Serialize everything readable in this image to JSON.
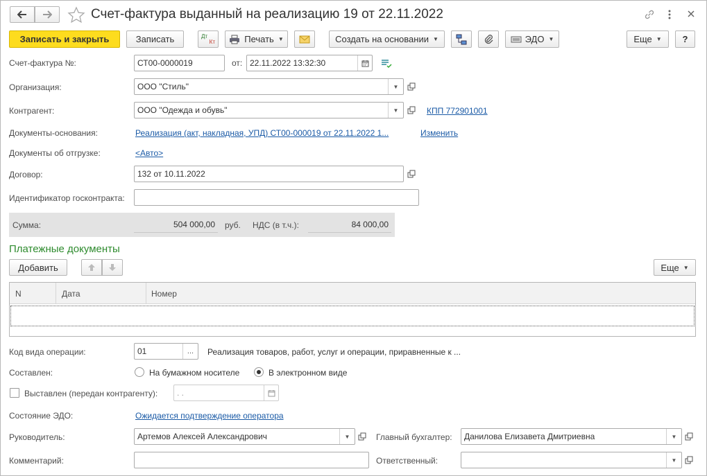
{
  "header": {
    "title": "Счет-фактура выданный на реализацию 19 от 22.11.2022"
  },
  "toolbar": {
    "save_close": "Записать и закрыть",
    "save": "Записать",
    "print": "Печать",
    "create_based": "Создать на основании",
    "edo": "ЭДО",
    "more": "Еще",
    "help": "?",
    "dtkt_top": "Дт",
    "dtkt_bottom": "Кт"
  },
  "form": {
    "invoice_label": "Счет-фактура №:",
    "invoice_number": "СТ00-0000019",
    "date_label": "от:",
    "date_value": "22.11.2022 13:32:30",
    "org_label": "Организация:",
    "org_value": "ООО \"Стиль\"",
    "contractor_label": "Контрагент:",
    "contractor_value": "ООО \"Одежда и обувь\"",
    "kpp_link": "КПП 772901001",
    "base_docs_label": "Документы-основания:",
    "base_docs_link": "Реализация (акт, накладная, УПД) СТ00-000019 от 22.11.2022 1...",
    "change_link": "Изменить",
    "shipment_docs_label": "Документы об отгрузке:",
    "shipment_docs_link": "<Авто>",
    "contract_label": "Договор:",
    "contract_value": "132 от 10.11.2022",
    "gov_id_label": "Идентификатор госконтракта:",
    "gov_id_value": "",
    "sum_label": "Сумма:",
    "sum_value": "504 000,00",
    "currency": "руб.",
    "vat_label": "НДС (в т.ч.):",
    "vat_value": "84 000,00"
  },
  "payments": {
    "title": "Платежные документы",
    "add": "Добавить",
    "more": "Еще",
    "columns": [
      "N",
      "Дата",
      "Номер"
    ]
  },
  "bottom": {
    "op_code_label": "Код вида операции:",
    "op_code_value": "01",
    "op_code_dots": "...",
    "op_code_desc": "Реализация товаров, работ, услуг и операции, приравненные к ...",
    "composed_label": "Составлен:",
    "radio_paper": "На бумажном носителе",
    "radio_electronic": "В электронном виде",
    "radio_selected": "electronic",
    "issued_label": "Выставлен (передан контрагенту):",
    "issued_date": "  .  .",
    "edo_state_label": "Состояние ЭДО:",
    "edo_state_link": "Ожидается подтверждение оператора",
    "head_label": "Руководитель:",
    "head_value": "Артемов Алексей Александрович",
    "chief_acc_label": "Главный бухгалтер:",
    "chief_acc_value": "Данилова Елизавета Дмитриевна",
    "comment_label": "Комментарий:",
    "comment_value": "",
    "responsible_label": "Ответственный:",
    "responsible_value": ""
  },
  "colors": {
    "primary": "#fddc1e",
    "link": "#1a5aa6",
    "section_title": "#2e8b2e",
    "sum_bg": "#e3e3e3"
  }
}
